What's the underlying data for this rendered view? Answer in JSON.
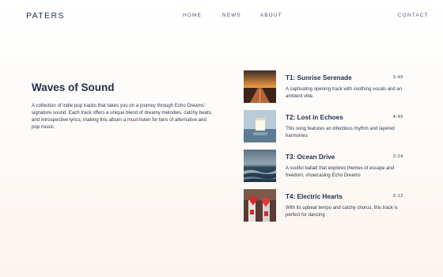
{
  "header": {
    "logo": "PATERS",
    "nav": [
      "HOME",
      "NEWS",
      "ABOUT"
    ],
    "contact": "CONTACT"
  },
  "album": {
    "title": "Waves of Sound",
    "description": "A collection of indie pop tracks that takes you on a journey through Echo Dreams' signature sound. Each track offers a unique blend of dreamy melodies, catchy beats, and introspective lyrics, making this album a must-listen for fans of alternative and pop music."
  },
  "tracks": [
    {
      "title": "T1: Sunrise Serenade",
      "duration": "3:45",
      "description": "A captivating opening track with soothing vocals and an ambient vibe.",
      "image": "sunset-road-image"
    },
    {
      "title": "T2:  Lost in Echoes",
      "duration": "4:45",
      "description": "This song features an infectious rhythm and layered harmonies",
      "image": "glowing-cube-image"
    },
    {
      "title": "T3:  Ocean Drive",
      "duration": "3:24",
      "description": "A soulful ballad that explores themes of escape and freedom, showcasing Echo Dreams",
      "image": "ocean-image"
    },
    {
      "title": "T4: Electric Hearts",
      "duration": "3:12",
      "description": "With its upbeat tempo and catchy chorus, this track is perfect for dancing",
      "image": "heart-figures-image"
    }
  ]
}
